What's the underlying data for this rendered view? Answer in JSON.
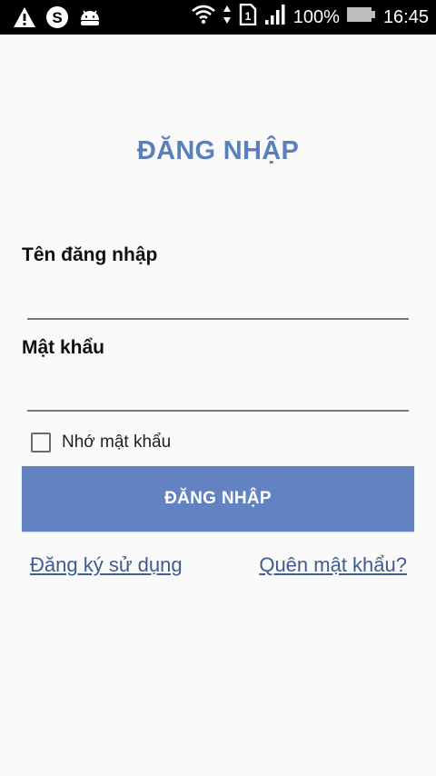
{
  "status_bar": {
    "left_icons": [
      "warning-icon",
      "skype-icon",
      "android-icon"
    ],
    "right_icons": [
      "wifi-icon",
      "data-arrows-icon",
      "sim-1-icon",
      "signal-icon",
      "battery-icon"
    ],
    "battery_percent": "100%",
    "time": "16:45"
  },
  "login": {
    "title": "ĐĂNG NHẬP",
    "username_label": "Tên đăng nhập",
    "username_value": "",
    "password_label": "Mật khẩu",
    "password_value": "",
    "remember_label": "Nhớ mật khẩu",
    "remember_checked": false,
    "submit_label": "ĐĂNG NHẬP",
    "register_link": "Đăng ký sử dụng",
    "forgot_link": "Quên mật khẩu?"
  },
  "colors": {
    "accent": "#6282c1",
    "title": "#5b7fbd",
    "link": "#3f5b93",
    "background": "#fafafa",
    "status_bar": "#000000"
  }
}
